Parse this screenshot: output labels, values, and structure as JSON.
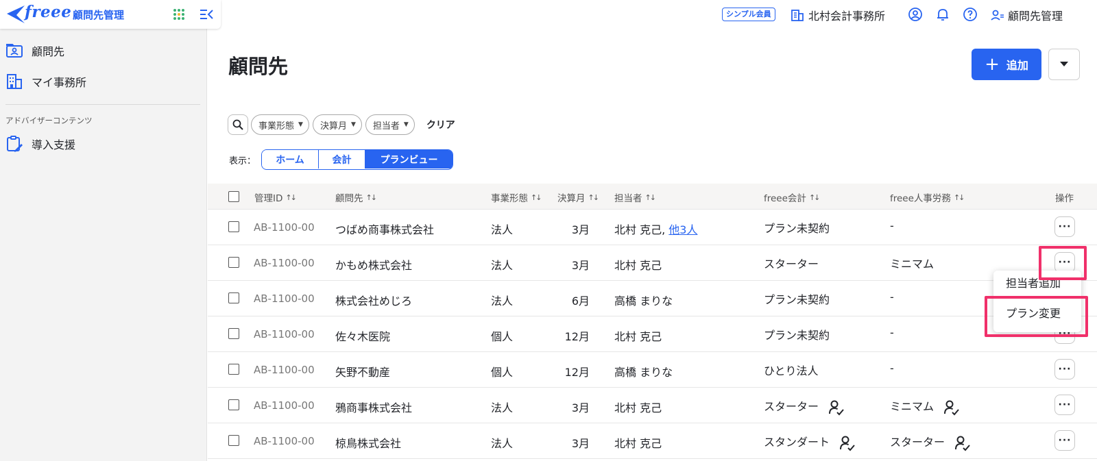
{
  "sidebar": {
    "logo_text": "freee",
    "logo_sub": "顧問先管理",
    "items": [
      {
        "label": "顧問先"
      },
      {
        "label": "マイ事務所"
      }
    ],
    "section_label": "アドバイザーコンテンツ",
    "section_items": [
      {
        "label": "導入支援"
      }
    ]
  },
  "header": {
    "plan_badge": "シンプル会員",
    "office_name": "北村会計事務所",
    "user_label": "顧問先管理"
  },
  "main": {
    "title": "顧問先",
    "add_label": "追加",
    "filters": [
      "事業形態",
      "決算月",
      "担当者"
    ],
    "clear_label": "クリア",
    "view_label": "表示：",
    "view_tabs": [
      {
        "label": "ホーム",
        "active": false
      },
      {
        "label": "会計",
        "active": false
      },
      {
        "label": "プランビュー",
        "active": true
      }
    ]
  },
  "table": {
    "columns": [
      "管理ID",
      "顧問先",
      "事業形態",
      "決算月",
      "担当者",
      "freee会計",
      "freee人事労務",
      "操作"
    ],
    "rows": [
      {
        "id": "AB-1100-00",
        "client": "つばめ商事株式会社",
        "type": "法人",
        "month": "3月",
        "staff": "北村 克己,",
        "staff_more": "他3人",
        "accounting": "プラン未契約",
        "acc_badge": false,
        "hr": "-",
        "hr_badge": false
      },
      {
        "id": "AB-1100-00",
        "client": "かもめ株式会社",
        "type": "法人",
        "month": "3月",
        "staff": "北村 克己",
        "staff_more": "",
        "accounting": "スターター",
        "acc_badge": false,
        "hr": "ミニマム",
        "hr_badge": false
      },
      {
        "id": "AB-1100-00",
        "client": "株式会社めじろ",
        "type": "法人",
        "month": "6月",
        "staff": "高橋 まりな",
        "staff_more": "",
        "accounting": "プラン未契約",
        "acc_badge": false,
        "hr": "-",
        "hr_badge": false
      },
      {
        "id": "AB-1100-00",
        "client": "佐々木医院",
        "type": "個人",
        "month": "12月",
        "staff": "北村 克己",
        "staff_more": "",
        "accounting": "プラン未契約",
        "acc_badge": false,
        "hr": "-",
        "hr_badge": false
      },
      {
        "id": "AB-1100-00",
        "client": "矢野不動産",
        "type": "個人",
        "month": "12月",
        "staff": "高橋 まりな",
        "staff_more": "",
        "accounting": "ひとり法人",
        "acc_badge": false,
        "hr": "-",
        "hr_badge": false
      },
      {
        "id": "AB-1100-00",
        "client": "鴉商事株式会社",
        "type": "法人",
        "month": "3月",
        "staff": "北村 克己",
        "staff_more": "",
        "accounting": "スターター",
        "acc_badge": true,
        "hr": "ミニマム",
        "hr_badge": true
      },
      {
        "id": "AB-1100-00",
        "client": "椋鳥株式会社",
        "type": "法人",
        "month": "3月",
        "staff": "北村 克己",
        "staff_more": "",
        "accounting": "スタンダート",
        "acc_badge": true,
        "hr": "スターター",
        "hr_badge": true
      }
    ]
  },
  "popup_menu": {
    "items": [
      "担当者追加",
      "プラン変更"
    ]
  },
  "colors": {
    "accent": "#2864f0",
    "highlight": "#f0306a",
    "sidebar_bg": "#f3f3f3"
  }
}
